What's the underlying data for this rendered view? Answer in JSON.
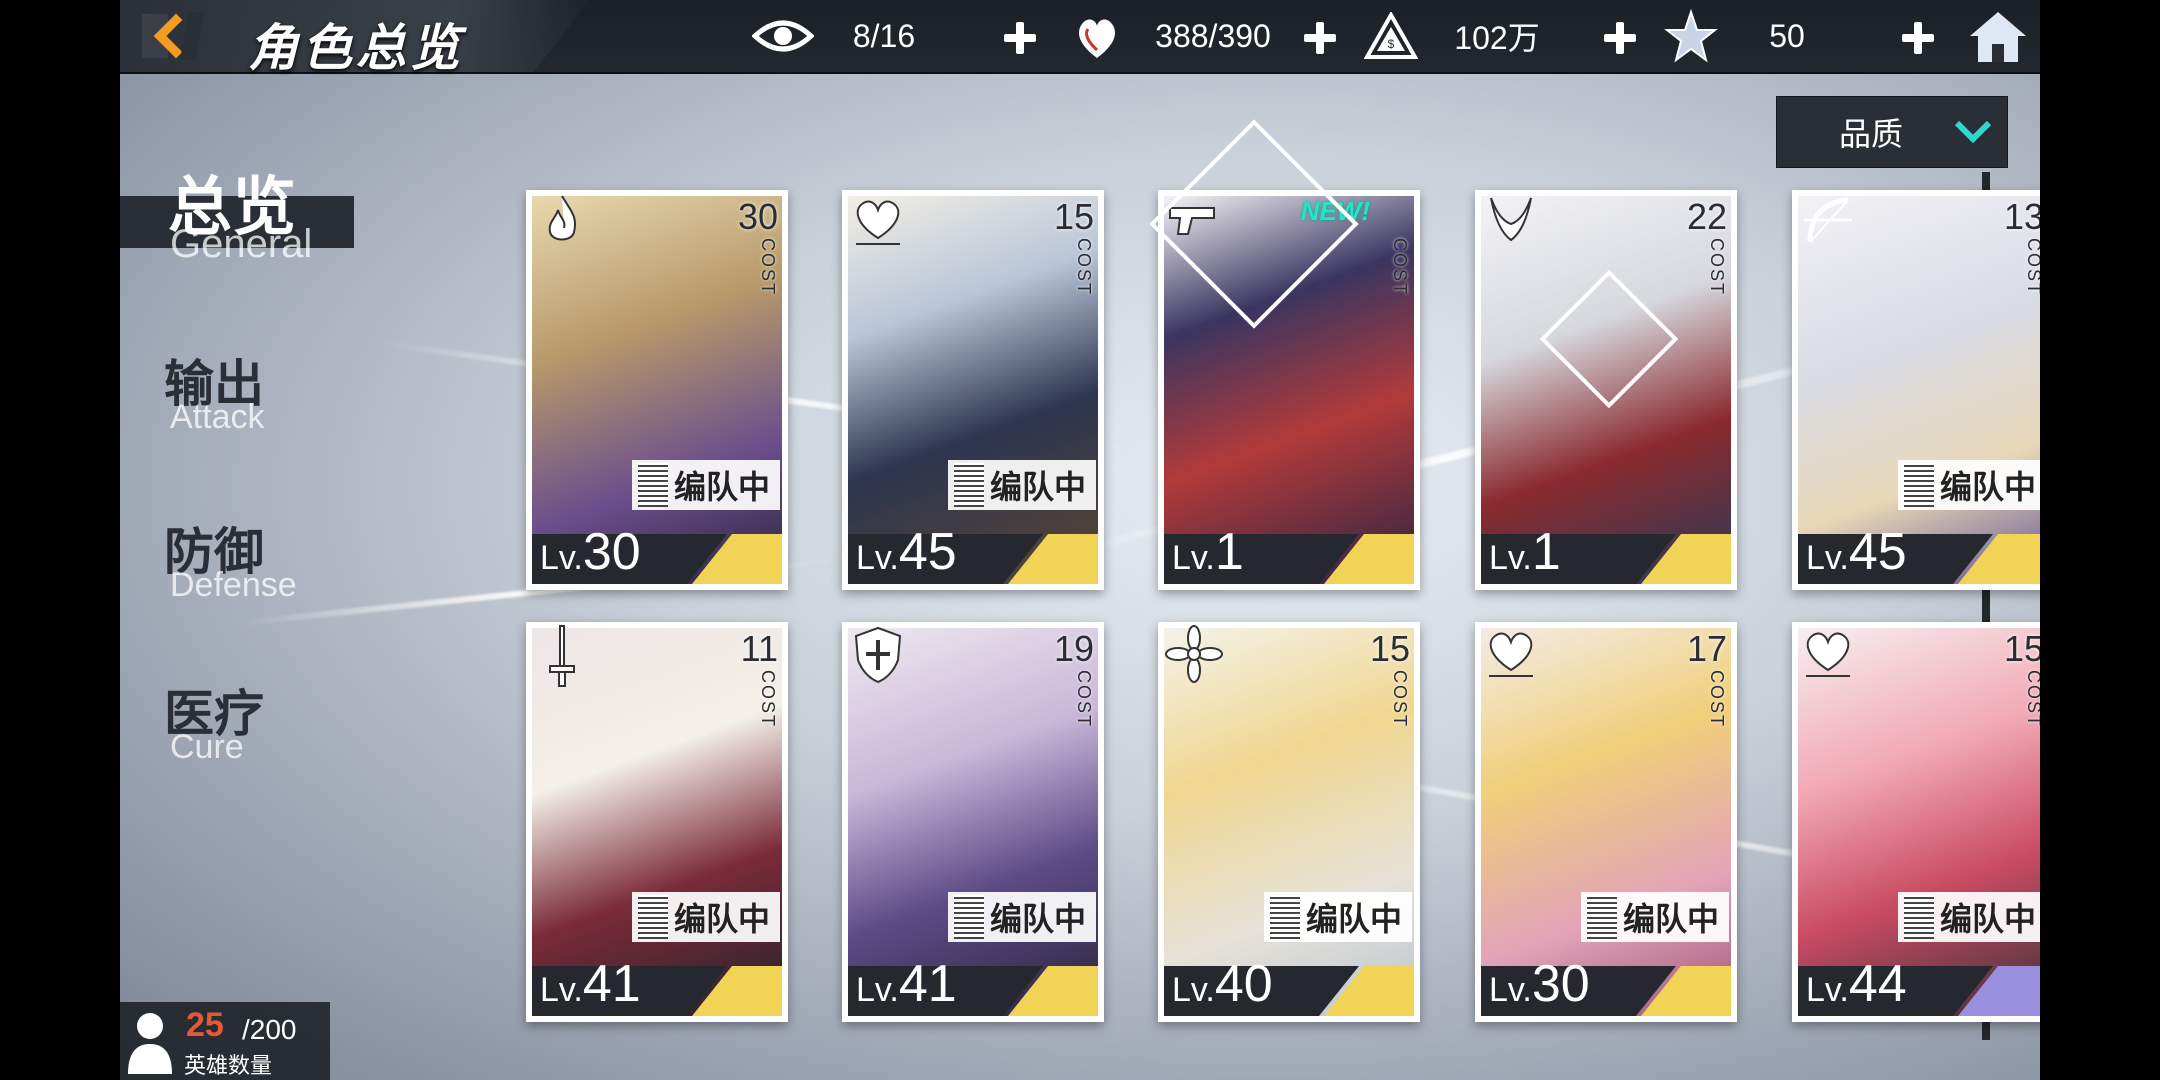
{
  "header": {
    "title": "角色总览",
    "resources": [
      {
        "icon": "eye-icon",
        "value": "8/16"
      },
      {
        "icon": "heart-icon",
        "value": "388/390"
      },
      {
        "icon": "gold-triangle-icon",
        "value": "102万"
      },
      {
        "icon": "star-crystal-icon",
        "value": "50"
      }
    ]
  },
  "sort": {
    "label": "品质"
  },
  "categories": [
    {
      "zh": "总览",
      "en": "General"
    },
    {
      "zh": "输出",
      "en": "Attack"
    },
    {
      "zh": "防御",
      "en": "Defense"
    },
    {
      "zh": "医疗",
      "en": "Cure"
    }
  ],
  "level_prefix": "Lv.",
  "cost_word": "COST",
  "cards": [
    {
      "class_icon": "fire-class-icon",
      "cost": "30",
      "level": "30",
      "in_team": "编队中",
      "badge_code": "00125",
      "new": "",
      "accent": "#f1d456"
    },
    {
      "class_icon": "heart-class-icon",
      "cost": "15",
      "level": "45",
      "in_team": "编队中",
      "badge_code": "00125",
      "new": "",
      "accent": "#f1d456"
    },
    {
      "class_icon": "gun-class-icon",
      "cost": "",
      "level": "1",
      "in_team": "",
      "badge_code": "",
      "new": "NEW!",
      "accent": "#f1d456"
    },
    {
      "class_icon": "horn-class-icon",
      "cost": "22",
      "level": "1",
      "in_team": "",
      "badge_code": "",
      "new": "",
      "accent": "#f1d456"
    },
    {
      "class_icon": "bow-class-icon",
      "cost": "13",
      "level": "45",
      "in_team": "编队中",
      "badge_code": "00125",
      "new": "",
      "accent": "#f1d456"
    },
    {
      "class_icon": "sword-class-icon",
      "cost": "11",
      "level": "41",
      "in_team": "编队中",
      "badge_code": "00125",
      "new": "",
      "accent": "#f1d456"
    },
    {
      "class_icon": "shield-class-icon",
      "cost": "19",
      "level": "41",
      "in_team": "编队中",
      "badge_code": "00125",
      "new": "",
      "accent": "#f1d456"
    },
    {
      "class_icon": "flower-class-icon",
      "cost": "15",
      "level": "40",
      "in_team": "编队中",
      "badge_code": "00125",
      "new": "",
      "accent": "#f1d456"
    },
    {
      "class_icon": "heart-class-icon",
      "cost": "17",
      "level": "30",
      "in_team": "编队中",
      "badge_code": "00125",
      "new": "",
      "accent": "#f1d456"
    },
    {
      "class_icon": "heart-class-icon",
      "cost": "15",
      "level": "44",
      "in_team": "编队中",
      "badge_code": "00125",
      "new": "",
      "accent": "#9b8fe0"
    }
  ],
  "hero_count": {
    "current": "25",
    "max": "/200",
    "label": "英雄数量"
  }
}
